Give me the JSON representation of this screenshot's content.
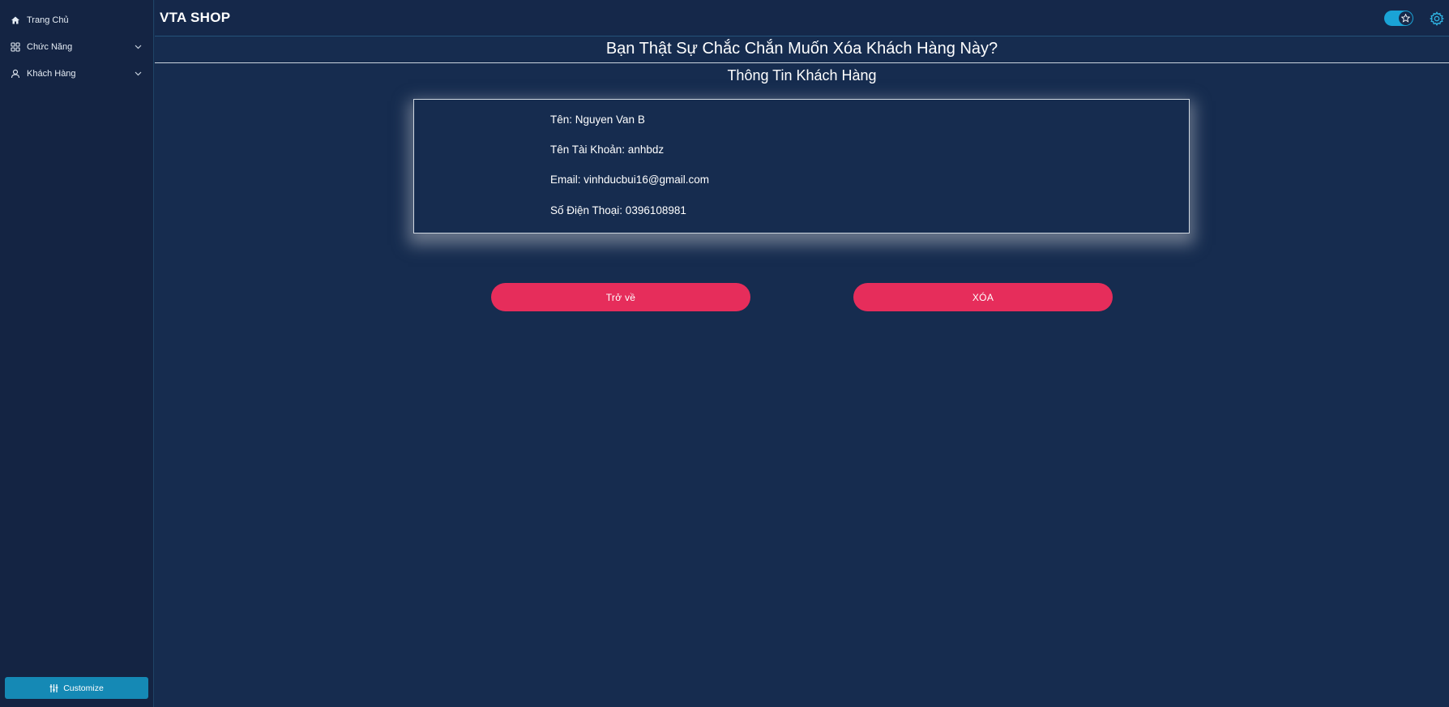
{
  "brand": {
    "title": "VTA SHOP"
  },
  "sidebar": {
    "items": [
      {
        "label": "Trang Chủ",
        "icon": "home-icon",
        "expandable": false
      },
      {
        "label": "Chức Năng",
        "icon": "grid-icon",
        "expandable": true
      },
      {
        "label": "Khách Hàng",
        "icon": "user-icon",
        "expandable": true
      }
    ],
    "customize_label": "Customize"
  },
  "header": {
    "theme_toggle_on": true
  },
  "page": {
    "confirm_title": "Bạn Thật Sự Chắc Chắn Muốn Xóa Khách Hàng Này?",
    "section_title": "Thông Tin Khách Hàng"
  },
  "customer": {
    "name": "Tên: Nguyen Van B",
    "username": "Tên Tài Khoản: anhbdz",
    "email": "Email: vinhducbui16@gmail.com",
    "phone": "Số Điện Thoại: 0396108981"
  },
  "actions": {
    "back_label": "Trở về",
    "delete_label": "XÓA"
  },
  "colors": {
    "background": "#162c4f",
    "sidebar": "#142443",
    "accent": "#1aa3d6",
    "danger": "#e62d5b"
  }
}
